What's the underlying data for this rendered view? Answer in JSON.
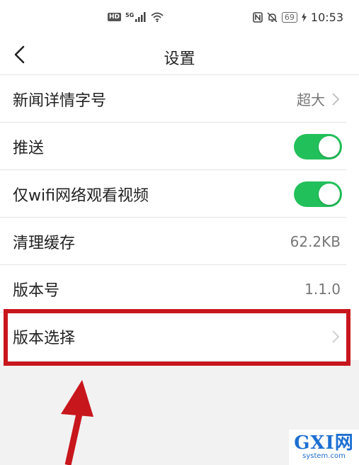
{
  "status_bar": {
    "hd_badge": "HD",
    "network": "5G",
    "battery": "69",
    "time": "10:53"
  },
  "header": {
    "title": "设置"
  },
  "settings": [
    {
      "label": "新闻详情字号",
      "value": "超大",
      "control": "chevron"
    },
    {
      "label": "推送",
      "control": "toggle",
      "state": "on"
    },
    {
      "label": "仅wifi网络观看视频",
      "control": "toggle",
      "state": "on"
    },
    {
      "label": "清理缓存",
      "value": "62.2KB",
      "control": "value"
    },
    {
      "label": "版本号",
      "value": "1.1.0",
      "control": "value"
    },
    {
      "label": "版本选择",
      "control": "chevron"
    }
  ],
  "watermark": {
    "main": "GXI网",
    "sub": "system.com"
  },
  "colors": {
    "toggle_on": "#22c05a",
    "highlight": "#c8161d",
    "watermark": "#1d6fd1"
  }
}
